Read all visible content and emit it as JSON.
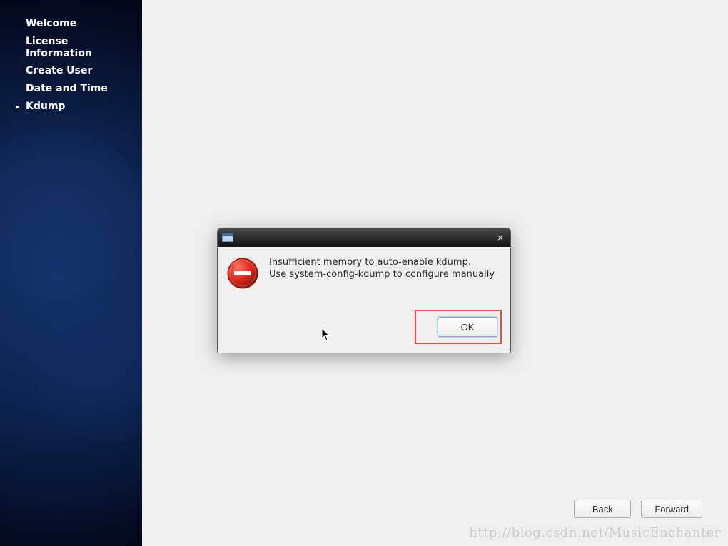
{
  "sidebar": {
    "items": [
      {
        "label": "Welcome",
        "active": false
      },
      {
        "label": "License Information",
        "active": false
      },
      {
        "label": "Create User",
        "active": false
      },
      {
        "label": "Date and Time",
        "active": false
      },
      {
        "label": "Kdump",
        "active": true
      }
    ]
  },
  "dialog": {
    "icon_name": "error-icon",
    "message_line1": "Insufficient memory to auto-enable kdump.",
    "message_line2": "Use system-config-kdump to configure manually",
    "ok_label": "OK",
    "close_symbol": "×"
  },
  "buttons": {
    "back_label": "Back",
    "forward_label": "Forward"
  },
  "watermark": "http://blog.csdn.net/MusicEnchanter"
}
